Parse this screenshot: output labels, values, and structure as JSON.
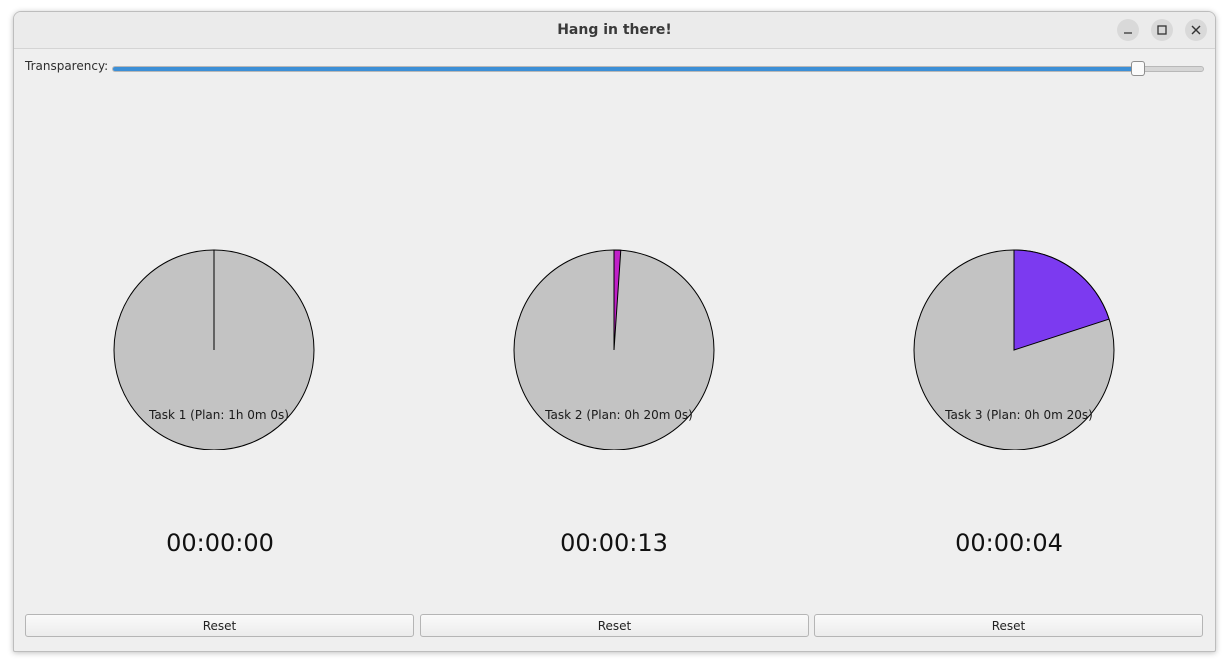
{
  "window": {
    "title": "Hang in there!",
    "controls": [
      "minimize-icon",
      "maximize-icon",
      "close-icon"
    ]
  },
  "transparency": {
    "label": "Transparency:",
    "value_fraction": 0.94
  },
  "colors": {
    "pie_background": "#c3c3c3",
    "task2_slice": "#c020c8",
    "task3_slice": "#7c3af0",
    "slider_accent": "#3c8fd6"
  },
  "tasks": [
    {
      "label": "Task 1 (Plan: 1h 0m 0s)",
      "elapsed": "00:00:00",
      "progress_fraction": 0.0,
      "slice_color": "#c020c8",
      "reset_label": "Reset"
    },
    {
      "label": "Task 2 (Plan: 0h 20m 0s)",
      "elapsed": "00:00:13",
      "progress_fraction": 0.0108,
      "slice_color": "#c020c8",
      "reset_label": "Reset"
    },
    {
      "label": "Task 3 (Plan: 0h 0m 20s)",
      "elapsed": "00:00:04",
      "progress_fraction": 0.2,
      "slice_color": "#7c3af0",
      "reset_label": "Reset"
    }
  ]
}
